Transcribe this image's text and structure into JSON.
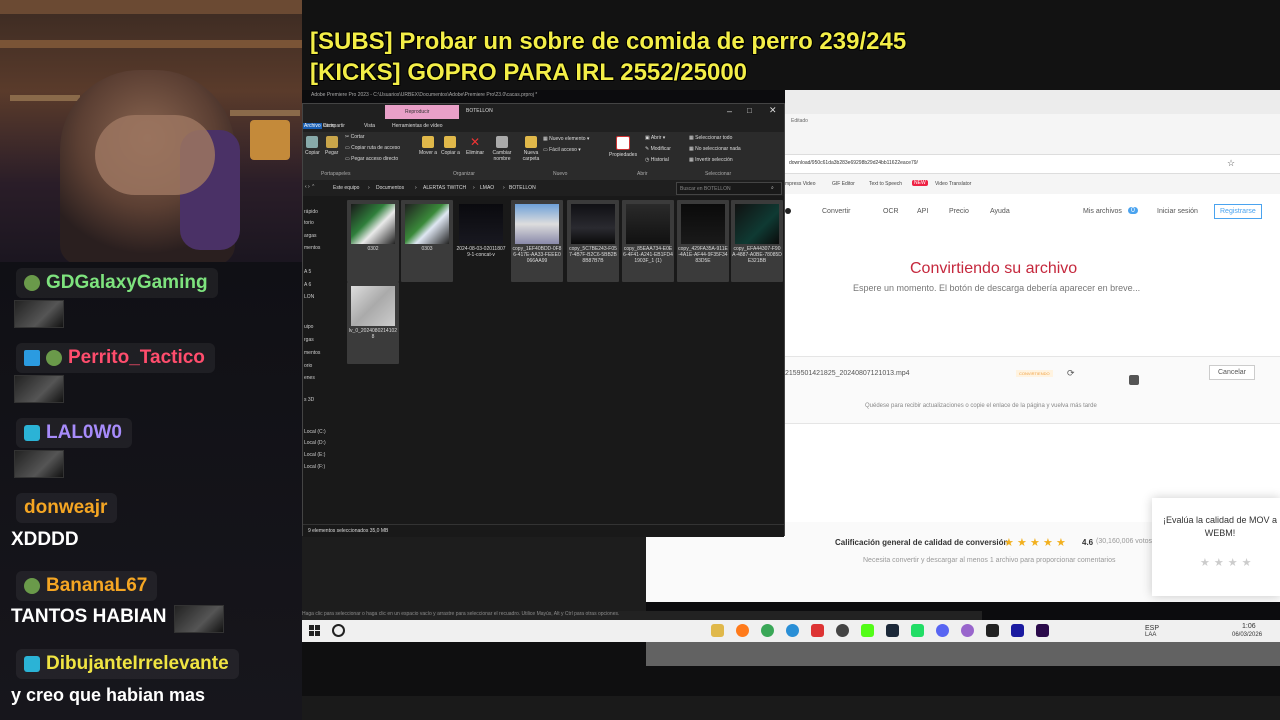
{
  "overlay": {
    "subs_line": "[SUBS] Probar un sobre de comida de perro 239/245",
    "kicks_line": "[KICKS] GOPRO PARA IRL 2552/25000"
  },
  "chat": {
    "messages": [
      {
        "user": "GDGalaxyGaming",
        "color": "#7ee37e",
        "text": ""
      },
      {
        "user": "Perrito_Tactico",
        "color": "#ff4d6d",
        "text": ""
      },
      {
        "user": "LAL0W0",
        "color": "#a78bfa",
        "text": ""
      },
      {
        "user": "donweajr",
        "color": "#f5a623",
        "text": "XDDDD"
      },
      {
        "user": "BananaL67",
        "color": "#f5a623",
        "text": "TANTOS HABIAN"
      },
      {
        "user": "DibujanteIrrelevante",
        "color": "#f0e442",
        "text": "y creo que habian mas"
      }
    ]
  },
  "explorer": {
    "title": "BOTELLON",
    "context_tab": "Reproducir",
    "tabs": [
      "Archivo",
      "Inicio",
      "Compartir",
      "Vista",
      "Herramientas de vídeo"
    ],
    "ribbon": {
      "copy": "Copiar",
      "paste": "Pegar",
      "cut": "Cortar",
      "copy_path": "Copiar ruta de acceso",
      "paste_shortcut": "Pegar acceso directo",
      "move_to": "Mover a",
      "copy_to": "Copiar a",
      "delete": "Eliminar",
      "rename": "Cambiar nombre",
      "new_folder": "Nueva carpeta",
      "new_item": "Nuevo elemento",
      "easy_access": "Fácil acceso",
      "properties": "Propiedades",
      "open": "Abrir",
      "modify": "Modificar",
      "history": "Historial",
      "select_all": "Seleccionar todo",
      "select_none": "No seleccionar nada",
      "invert_selection": "Invertir selección",
      "group_clipboard": "Portapapeles",
      "group_organize": "Organizar",
      "group_new": "Nuevo",
      "group_open": "Abrir",
      "group_select": "Seleccionar"
    },
    "breadcrumb": [
      "Este equipo",
      "Documentos",
      "ALERTAS TWITCH",
      "LMAO",
      "BOTELLON"
    ],
    "search_placeholder": "Buscar en BOTELLON",
    "nav_items": [
      "rápido",
      "torio",
      "argas",
      "mentos",
      "A 5",
      "A 6",
      "LON",
      "uipo",
      "rgas",
      "mentos",
      "orio",
      "enes",
      "s 3D",
      "Local (C:)",
      "Local (D:)",
      "Local (E:)",
      "Local (F:)"
    ],
    "files": [
      {
        "name": "0302",
        "selected": true
      },
      {
        "name": "0303",
        "selected": true
      },
      {
        "name": "2024-08-03-020118079-1-concat-v",
        "selected": false
      },
      {
        "name": "copy_1EF40BDD-0F86-417E-AA33-FEEE0066AA99",
        "selected": true
      },
      {
        "name": "copy_5C7BE243-F057-4B7F-B2C6-5BB2B8B87B7B",
        "selected": true
      },
      {
        "name": "copy_85EAA734-E0E6-4F41-A241-EB1FD41903F_1 (1)",
        "selected": true
      },
      {
        "name": "copy_429FA35A-911E-4A1E-AF44-9F35F3483D5E",
        "selected": true
      },
      {
        "name": "copy_EFA44307-F90A-4887-A0BE-78085DE321BB",
        "selected": true
      },
      {
        "name": "lv_0_20240802141028",
        "selected": true
      }
    ],
    "status": "9 elementos seleccionados  35,0 MB"
  },
  "browser": {
    "premiere_title": "Adobe Premiere Pro 2023 - C:\\Usuarios\\URBEX\\Documentos\\Adobe\\Premiere Pro\\23.0\\cacas.prproj *",
    "url": "download/950c61da3b283e69298b29d24bb11622eace79/",
    "bookmarks": [
      "mpress Video",
      "GIF Editor",
      "Text to Speech",
      "Video Translator"
    ],
    "text_to_speech_badge": "NEW",
    "nav": [
      "Convertir",
      "OCR",
      "API",
      "Precio",
      "Ayuda"
    ],
    "my_files": "Mis archivos",
    "my_files_count": "0",
    "login": "Iniciar sesión",
    "register": "Registrarse",
    "heading": "Convirtiendo su archivo",
    "subheading": "Espere un momento. El botón de descarga debería aparecer en breve...",
    "file_name": "2159501421825_20240807121013.mp4",
    "file_status": "CONVIRTIENDO",
    "cancel": "Cancelar",
    "hint": "Quédese para recibir actualizaciones o copie el enlace de la página y vuelva más tarde",
    "rating_label": "Calificación general de calidad de conversión",
    "rating_value": "4.6",
    "rating_votes": "(30,160,006 votos)",
    "rating_hint": "Necesita convertir y descargar al menos 1 archivo para proporcionar comentarios",
    "popup_text": "¡Evalúa la calidad de MOV a WEBM!",
    "window_state": "Editado",
    "accent": "#c5283d"
  },
  "premiere": {
    "hint": "Haga clic para seleccionar o haga clic en un espacio vacío y arrastre para seleccionar el recuadro. Utilice Mayús, Alt y Ctrl para otras opciones."
  },
  "taskbar": {
    "lang": "ESP",
    "lang2": "LAA",
    "time": "1:06",
    "date": "06/03/2026"
  }
}
